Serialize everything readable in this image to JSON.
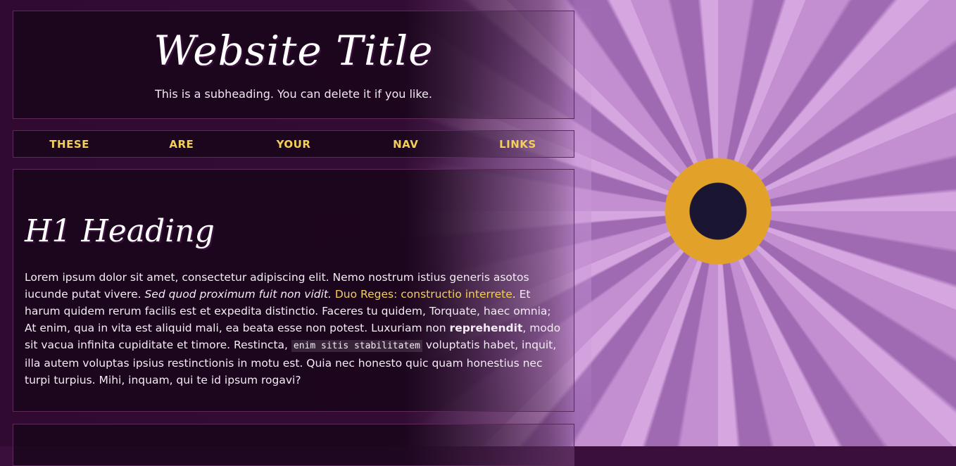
{
  "header": {
    "title": "Website Title",
    "subheading": "This is a subheading. You can delete it if you like."
  },
  "nav": {
    "links": [
      "THESE",
      "ARE",
      "YOUR",
      "NAV",
      "LINKS"
    ]
  },
  "main": {
    "heading": "H1 Heading",
    "p_part1": "Lorem ipsum dolor sit amet, consectetur adipiscing elit. Nemo nostrum istius generis asotos iucunde putat vivere. ",
    "p_em": "Sed quod proximum fuit non vidit.",
    "p_space": " ",
    "p_link": "Duo Reges: constructio interrete",
    "p_part2": ". Et harum quidem rerum facilis est et expedita distinctio. Faceres tu quidem, Torquate, haec omnia; At enim, qua in vita est aliquid mali, ea beata esse non potest. Luxuriam non ",
    "p_strong": "reprehendit",
    "p_part3": ", modo sit vacua infinita cupiditate et timore. Restincta, ",
    "p_code": "enim sitis stabilitatem",
    "p_part4": " voluptatis habet, inquit, illa autem voluptas ipsius restinctionis in motu est. Quia nec honesto quic quam honestius nec turpi turpius. Mihi, inquam, qui te id ipsum rogavi?"
  },
  "colors": {
    "accent": "#f3cf57",
    "background": "#3a0f3b"
  }
}
